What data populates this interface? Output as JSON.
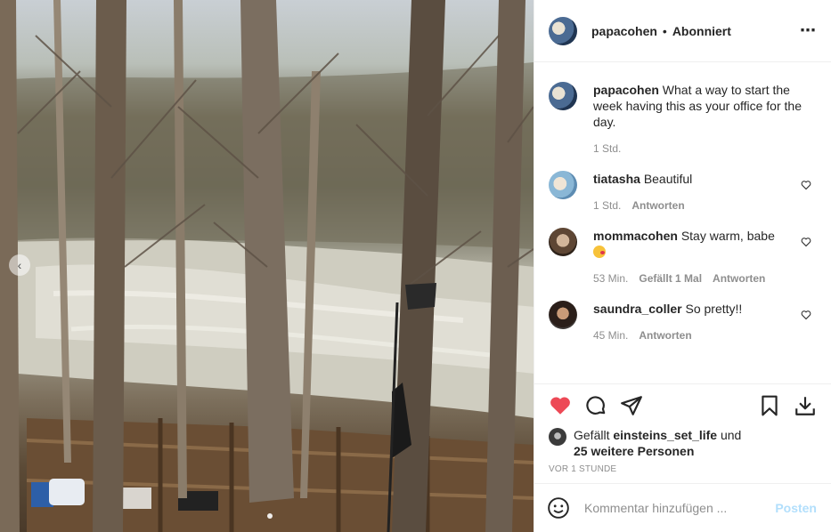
{
  "post": {
    "username": "papacohen",
    "follow_status": "Abonniert",
    "caption": "What a way to start the week having this as your office for the day.",
    "caption_time": "1 Std."
  },
  "comments": [
    {
      "username": "tiatasha",
      "text": "Beautiful",
      "time": "1 Std.",
      "likes": "",
      "reply": "Antworten"
    },
    {
      "username": "mommacohen",
      "text": "Stay warm, babe",
      "time": "53 Min.",
      "likes": "Gefällt 1 Mal",
      "reply": "Antworten"
    },
    {
      "username": "saundra_coller",
      "text": "So pretty!!",
      "time": "45 Min.",
      "likes": "",
      "reply": "Antworten"
    }
  ],
  "likes": {
    "prefix": "Gefällt",
    "user": "einsteins_set_life",
    "joiner": "und",
    "others": "25 weitere Personen"
  },
  "timestamp": "VOR 1 STUNDE",
  "composer": {
    "placeholder": "Kommentar hinzufügen ...",
    "post_label": "Posten"
  },
  "icons": {
    "like": "heart-filled-icon",
    "comment": "comment-bubble-icon",
    "share": "paper-plane-icon",
    "save": "bookmark-icon",
    "download": "download-icon",
    "emoji": "smiley-icon",
    "more": "more-dots-icon"
  },
  "colors": {
    "like_red": "#ed4956",
    "post_disabled": "#b2dffc",
    "muted": "#8e8e8e"
  }
}
